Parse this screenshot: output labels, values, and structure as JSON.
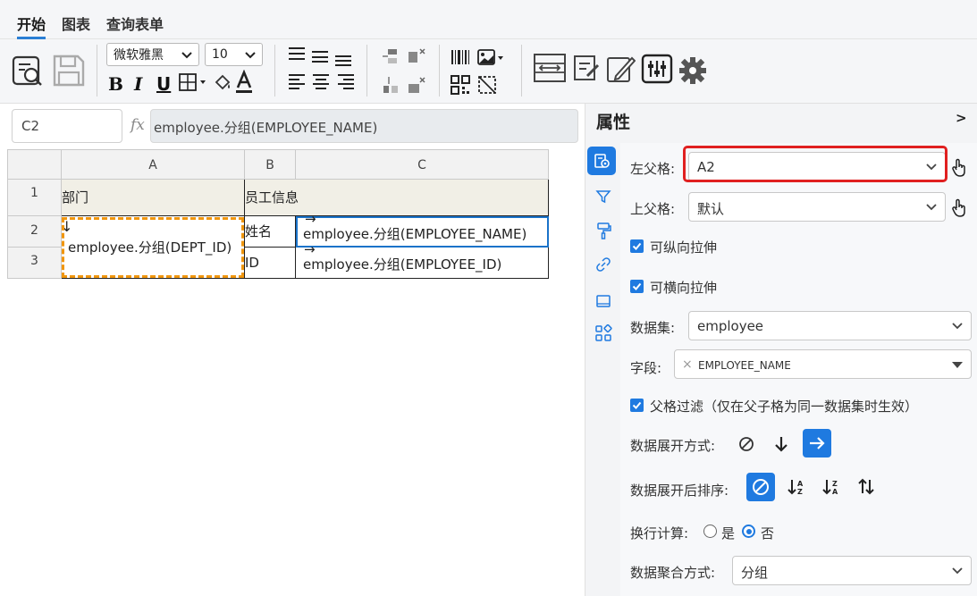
{
  "tabs": [
    {
      "label": "开始",
      "active": true
    },
    {
      "label": "图表",
      "active": false
    },
    {
      "label": "查询表单",
      "active": false
    }
  ],
  "toolbar": {
    "font_family": "微软雅黑",
    "font_size": "10",
    "format_buttons": [
      "B",
      "I",
      "U"
    ]
  },
  "formula_bar": {
    "cell_ref": "C2",
    "fx": "fx",
    "formula": "employee.分组(EMPLOYEE_NAME)"
  },
  "sheet": {
    "columns": [
      "A",
      "B",
      "C"
    ],
    "rows": [
      "1",
      "2",
      "3"
    ],
    "cells": {
      "A1": "部门",
      "B1": "员工信息",
      "A2": "employee.分组(DEPT_ID)",
      "A2_arrow": "↓",
      "B2": "姓名",
      "C2": "employee.分组(EMPLOYEE_NAME)",
      "C2_arrow": "→",
      "B3": "ID",
      "C3": "employee.分组(EMPLOYEE_ID)",
      "C3_arrow": "→"
    }
  },
  "panel": {
    "title": "属性",
    "collapse": ">",
    "left_parent": {
      "label": "左父格:",
      "value": "A2"
    },
    "top_parent": {
      "label": "上父格:",
      "value": "默认"
    },
    "vertical_stretch": {
      "label": "可纵向拉伸",
      "checked": true
    },
    "horizontal_stretch": {
      "label": "可横向拉伸",
      "checked": true
    },
    "dataset": {
      "label": "数据集:",
      "value": "employee"
    },
    "field": {
      "label": "字段:",
      "tag": "EMPLOYEE_NAME",
      "tag_remove": "×"
    },
    "parent_filter": {
      "label": "父格过滤（仅在父子格为同一数据集时生效）",
      "checked": true
    },
    "expand_mode": {
      "label": "数据展开方式:",
      "selected": "horizontal"
    },
    "expand_sort": {
      "label": "数据展开后排序:",
      "selected": "none"
    },
    "wrap_calc": {
      "label": "换行计算:",
      "options": [
        "是",
        "否"
      ],
      "selected": "否"
    },
    "aggregate": {
      "label": "数据聚合方式:",
      "value": "分组"
    }
  },
  "colors": {
    "accent": "#1f7ae0",
    "highlight_box": "#e02020",
    "selection_dashed": "#f0960e",
    "header_bg": "#f2f2f2",
    "title_row_bg": "#f1efe6"
  }
}
